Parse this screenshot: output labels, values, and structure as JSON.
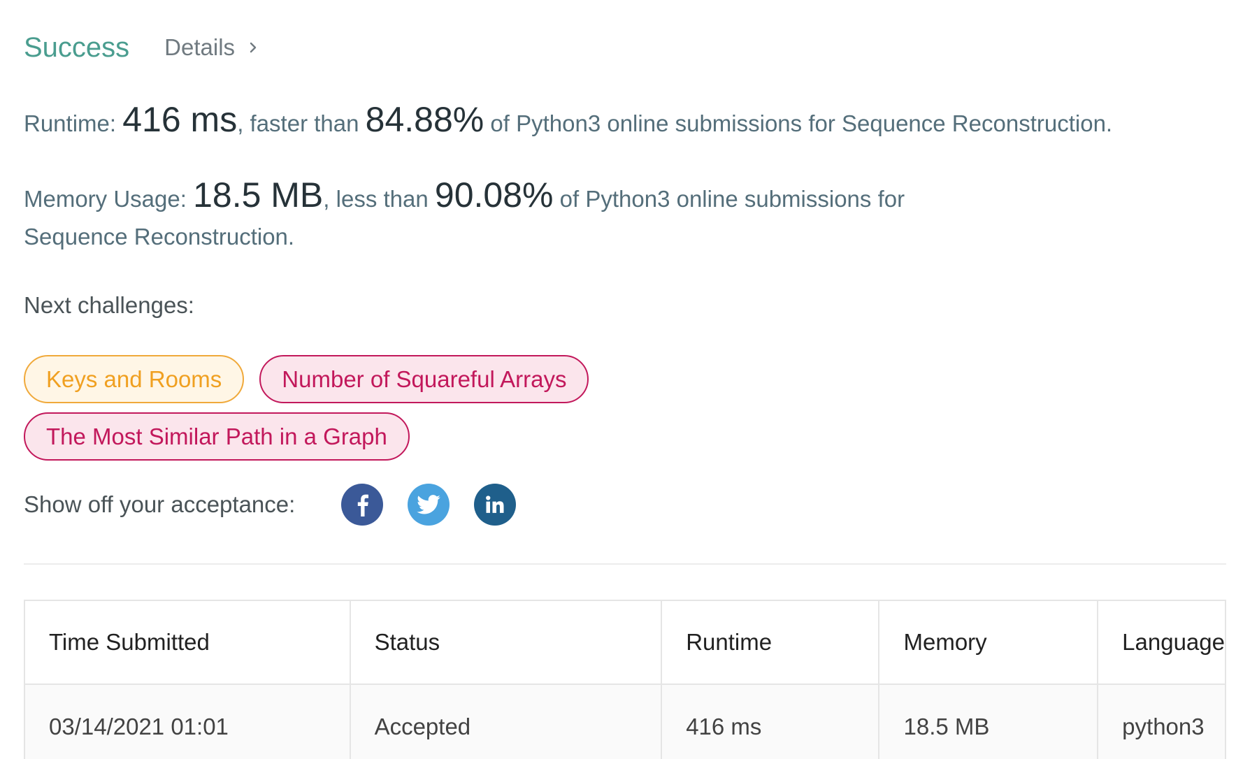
{
  "status": {
    "title": "Success",
    "details_label": "Details"
  },
  "runtime": {
    "label": "Runtime:",
    "value": "416 ms",
    "middle": ", faster than",
    "percent": "84.88%",
    "tail": "of Python3 online submissions for Sequence Reconstruction."
  },
  "memory": {
    "label": "Memory Usage:",
    "value": "18.5 MB",
    "middle": ", less than",
    "percent": "90.08%",
    "tail": "of Python3 online submissions for Sequence Reconstruction."
  },
  "next_challenges": {
    "label": "Next challenges:",
    "items": [
      {
        "label": "Keys and Rooms",
        "difficulty": "medium"
      },
      {
        "label": "Number of Squareful Arrays",
        "difficulty": "hard"
      },
      {
        "label": "The Most Similar Path in a Graph",
        "difficulty": "hard"
      }
    ]
  },
  "share": {
    "label": "Show off your acceptance:",
    "icons": [
      "facebook-icon",
      "twitter-icon",
      "linkedin-icon"
    ]
  },
  "table": {
    "headers": [
      "Time Submitted",
      "Status",
      "Runtime",
      "Memory",
      "Language"
    ],
    "rows": [
      [
        "03/14/2021 01:01",
        "Accepted",
        "416 ms",
        "18.5 MB",
        "python3"
      ]
    ]
  },
  "colors": {
    "success": "#4a9d8f",
    "medium": "#f0a021",
    "hard": "#c2185b",
    "facebook": "#3b5998",
    "twitter": "#4aa3df",
    "linkedin": "#1f5f8b"
  }
}
